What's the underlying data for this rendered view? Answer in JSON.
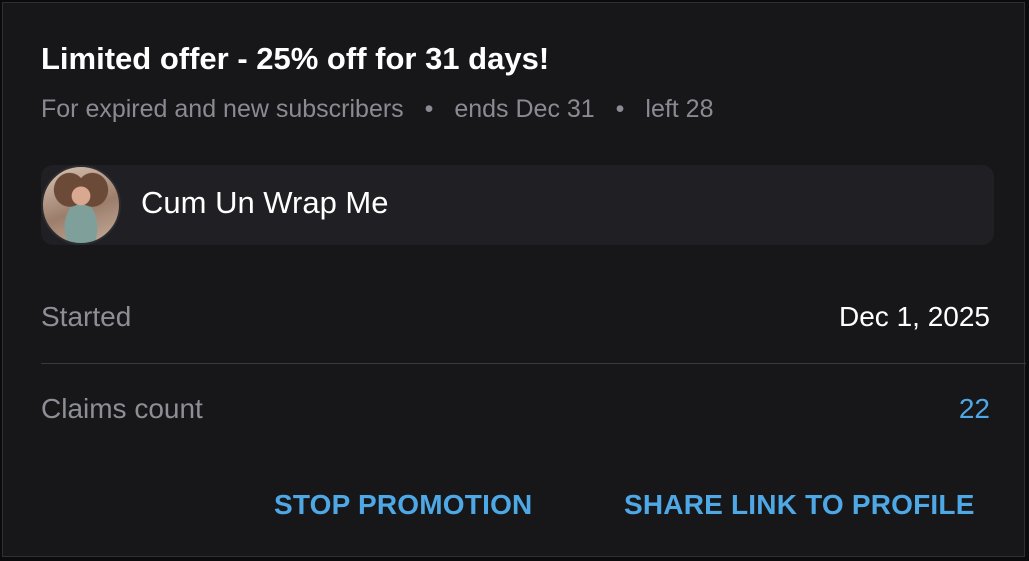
{
  "offer": {
    "title": "Limited offer - 25% off for 31 days!",
    "audience": "For expired and new subscribers",
    "ends": "ends Dec 31",
    "left": "left 28",
    "separator": "•"
  },
  "profile": {
    "name": "Cum Un Wrap Me",
    "avatar_icon": "profile-avatar-photo"
  },
  "details": {
    "started_label": "Started",
    "started_value": "Dec 1, 2025",
    "claims_label": "Claims count",
    "claims_value": "22"
  },
  "actions": {
    "stop_label": "STOP PROMOTION",
    "share_label": "SHARE LINK TO PROFILE"
  },
  "colors": {
    "background": "#17171a",
    "accent": "#4ea8e6",
    "muted": "#8e8e96",
    "text": "#ffffff"
  }
}
